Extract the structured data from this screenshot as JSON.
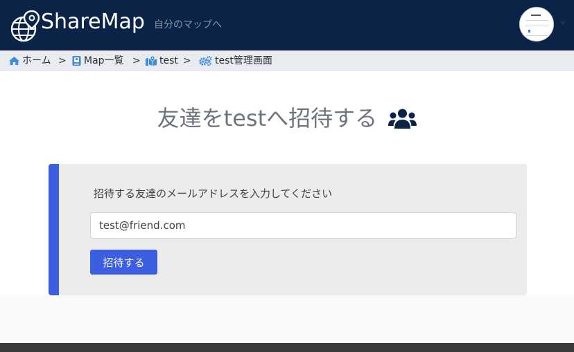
{
  "navbar": {
    "brand_name": "ShareMap",
    "tagline": "自分のマップへ"
  },
  "breadcrumb": {
    "items": [
      {
        "label": "ホーム",
        "icon": "home-icon"
      },
      {
        "label": "Map一覧",
        "icon": "address-book-icon"
      },
      {
        "label": "test",
        "icon": "map-icon"
      },
      {
        "label": "test管理画面",
        "icon": "gears-icon"
      }
    ],
    "separator": ">"
  },
  "main": {
    "title": "友達をtestへ招待する",
    "title_icon": "users-icon",
    "form": {
      "label": "招待する友達のメールアドレスを入力してください",
      "email_value": "test@friend.com",
      "submit_label": "招待する"
    }
  },
  "colors": {
    "navbar_bg": "#0b2346",
    "accent": "#3b5fe0",
    "breadcrumb_icon": "#3d8bd9",
    "breadcrumb_bg": "#e8ebef"
  }
}
